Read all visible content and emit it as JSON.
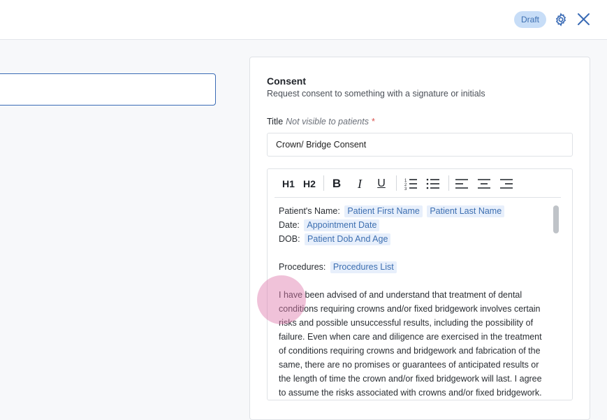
{
  "header": {
    "status_badge": "Draft",
    "icons": [
      "gear-icon",
      "close-icon"
    ]
  },
  "left_panel": {
    "input_value": ""
  },
  "consent_panel": {
    "title": "Consent",
    "subtitle": "Request consent to something with a signature or initials",
    "field_label": "Title",
    "field_hint": "Not visible to patients",
    "required_marker": "*",
    "title_value": "Crown/ Bridge Consent",
    "toolbar": {
      "h1": "H1",
      "h2": "H2",
      "bold": "B",
      "italic": "I",
      "underline": "U",
      "icons": [
        "ordered-list-icon",
        "bullet-list-icon",
        "align-left-icon",
        "align-center-icon",
        "align-right-icon"
      ]
    },
    "body": {
      "name_label": "Patient's Name:",
      "first_name_chip": "Patient First Name",
      "last_name_chip": "Patient Last Name",
      "date_label": "Date:",
      "date_chip": "Appointment Date",
      "dob_label": "DOB:",
      "dob_chip": "Patient Dob And Age",
      "procedures_label": "Procedures:",
      "procedures_chip": "Procedures List",
      "paragraph_lines": [
        "I have been advised of and understand that treatment of dental",
        "conditions requiring crowns and/or fixed bridgework involves certain",
        "risks and possible unsuccessful results, including the possibility of",
        "failure. Even when care and diligence are exercised in the treatment",
        "of conditions requiring crowns and bridgework and fabrication of the",
        "same, there are no promises or guarantees of anticipated results or",
        "the length of time the crown and/or fixed bridgework will last. I agree",
        "to assume the risks associated with crowns and/or fixed bridgework."
      ]
    }
  },
  "colors": {
    "accent": "#3a6bb5",
    "badge_bg": "#c7ddf7",
    "chip_bg": "#e7effb",
    "required": "#d9534f",
    "touch_indicator": "#dd78aa"
  }
}
